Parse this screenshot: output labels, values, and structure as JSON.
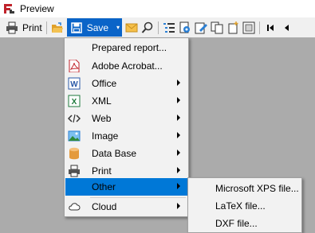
{
  "window": {
    "title": "Preview"
  },
  "toolbar": {
    "print_label": "Print",
    "save_label": "Save",
    "icons": [
      "print-icon",
      "open-icon",
      "save-icon",
      "email-icon",
      "find-icon",
      "outline-icon",
      "settings-icon",
      "edit-icon",
      "copy-page-icon",
      "new-page-icon",
      "delete-page-icon",
      "first-page-icon",
      "previous-page-icon"
    ]
  },
  "save_menu": {
    "items": [
      {
        "label": "Prepared report...",
        "icon": "none"
      },
      {
        "label": "Adobe Acrobat...",
        "icon": "pdf-icon"
      },
      {
        "label": "Office",
        "icon": "word-icon",
        "submenu": true
      },
      {
        "label": "XML",
        "icon": "excel-icon",
        "submenu": true
      },
      {
        "label": "Web",
        "icon": "code-icon",
        "submenu": true
      },
      {
        "label": "Image",
        "icon": "image-icon",
        "submenu": true
      },
      {
        "label": "Data Base",
        "icon": "database-icon",
        "submenu": true
      },
      {
        "label": "Print",
        "icon": "print-icon",
        "submenu": true
      },
      {
        "label": "Other",
        "icon": "none",
        "submenu": true,
        "selected": true
      },
      {
        "label": "Cloud",
        "icon": "cloud-icon",
        "submenu": true
      }
    ]
  },
  "other_submenu": {
    "items": [
      {
        "label": "Microsoft XPS file..."
      },
      {
        "label": "LaTeX file..."
      },
      {
        "label": "DXF file..."
      }
    ]
  },
  "colors": {
    "selection": "#0078d7",
    "save_button": "#0a64c8",
    "background": "#ababab"
  }
}
